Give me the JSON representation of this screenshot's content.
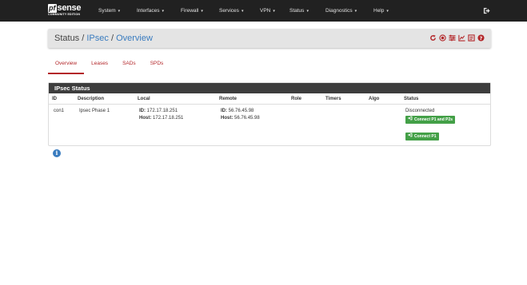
{
  "brand": {
    "logo_pf": "pf",
    "logo_sense": "sense",
    "edition": "COMMUNITY EDITION"
  },
  "nav": {
    "items": [
      {
        "label": "System"
      },
      {
        "label": "Interfaces"
      },
      {
        "label": "Firewall"
      },
      {
        "label": "Services"
      },
      {
        "label": "VPN"
      },
      {
        "label": "Status"
      },
      {
        "label": "Diagnostics"
      },
      {
        "label": "Help"
      }
    ],
    "caret": "▾",
    "logout_icon": "sign-out-icon"
  },
  "breadcrumb": {
    "status": "Status",
    "ipsec": "IPsec",
    "overview": "Overview",
    "sep": "/"
  },
  "toolbar_icons": [
    "reload-icon",
    "record-icon",
    "settings-sliders-icon",
    "chart-icon",
    "list-icon",
    "help-icon"
  ],
  "colors": {
    "accent": "#b3272a",
    "link": "#3a7cbf",
    "navbar": "#212121",
    "button_green": "#43a047",
    "panel_heading": "#3d3d3d"
  },
  "tabs": [
    {
      "label": "Overview",
      "active": true
    },
    {
      "label": "Leases",
      "active": false
    },
    {
      "label": "SADs",
      "active": false
    },
    {
      "label": "SPDs",
      "active": false
    }
  ],
  "panel": {
    "title": "IPsec Status",
    "columns": [
      "ID",
      "Description",
      "Local",
      "Remote",
      "Role",
      "Timers",
      "Algo",
      "Status"
    ],
    "rows": [
      {
        "id": "con1",
        "description": "Ipsec Phase 1",
        "local_id_label": "ID:",
        "local_id": "172.17.18.251",
        "local_host_label": "Host:",
        "local_host": "172.17.18.251",
        "remote_id_label": "ID:",
        "remote_id": "56.76.45.98",
        "remote_host_label": "Host:",
        "remote_host": "56.76.45.98",
        "role": "",
        "timers": "",
        "algo": "",
        "status": "Disconnected",
        "btn_connect_both": "Connect P1 and P2s",
        "btn_connect_p1": "Connect P1"
      }
    ]
  },
  "info_icon": "i"
}
